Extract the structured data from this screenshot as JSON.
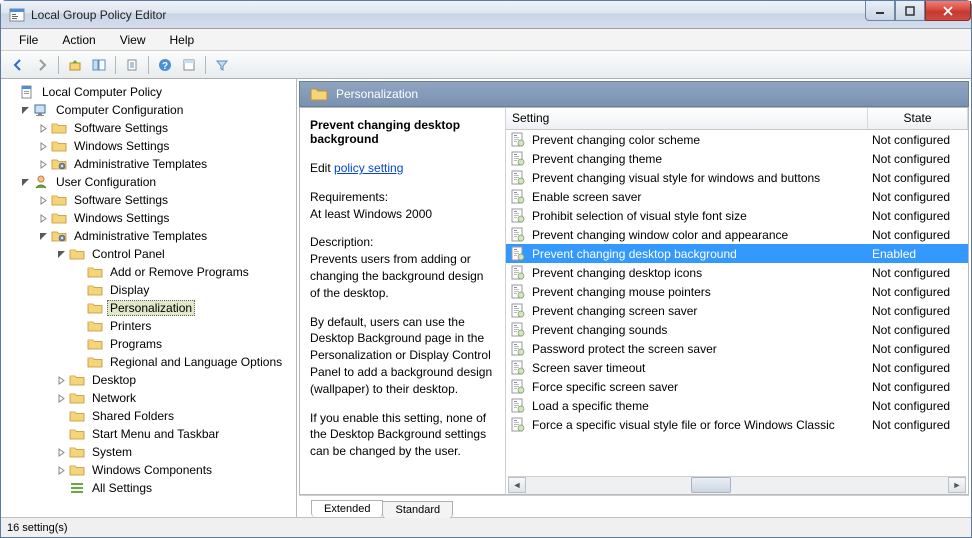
{
  "window": {
    "title": "Local Group Policy Editor"
  },
  "menu": {
    "file": "File",
    "action": "Action",
    "view": "View",
    "help": "Help"
  },
  "tree": {
    "root": "Local Computer Policy",
    "cc": "Computer Configuration",
    "cc_sw": "Software Settings",
    "cc_win": "Windows Settings",
    "cc_admin": "Administrative Templates",
    "uc": "User Configuration",
    "uc_sw": "Software Settings",
    "uc_win": "Windows Settings",
    "uc_admin": "Administrative Templates",
    "cp": "Control Panel",
    "cp_add": "Add or Remove Programs",
    "cp_disp": "Display",
    "cp_pers": "Personalization",
    "cp_print": "Printers",
    "cp_prog": "Programs",
    "cp_reg": "Regional and Language Options",
    "desktop": "Desktop",
    "network": "Network",
    "shared": "Shared Folders",
    "start": "Start Menu and Taskbar",
    "system": "System",
    "wincomp": "Windows Components",
    "allset": "All Settings"
  },
  "header": {
    "title": "Personalization"
  },
  "desc": {
    "title": "Prevent changing desktop background",
    "edit_prefix": "Edit ",
    "edit_link": "policy setting",
    "req_label": "Requirements:",
    "req_text": "At least Windows 2000",
    "desc_label": "Description:",
    "p1": "Prevents users from adding or changing the background design of the desktop.",
    "p2": "By default, users can use the Desktop Background page in the Personalization or Display Control Panel to add a background design (wallpaper) to their desktop.",
    "p3": "If you enable this setting, none of the Desktop Background settings can be changed by the user."
  },
  "cols": {
    "setting": "Setting",
    "state": "State"
  },
  "settings": [
    {
      "name": "Prevent changing color scheme",
      "state": "Not configured",
      "sel": false
    },
    {
      "name": "Prevent changing theme",
      "state": "Not configured",
      "sel": false
    },
    {
      "name": "Prevent changing visual style for windows and buttons",
      "state": "Not configured",
      "sel": false
    },
    {
      "name": "Enable screen saver",
      "state": "Not configured",
      "sel": false
    },
    {
      "name": "Prohibit selection of visual style font size",
      "state": "Not configured",
      "sel": false
    },
    {
      "name": "Prevent changing window color and appearance",
      "state": "Not configured",
      "sel": false
    },
    {
      "name": "Prevent changing desktop background",
      "state": "Enabled",
      "sel": true
    },
    {
      "name": "Prevent changing desktop icons",
      "state": "Not configured",
      "sel": false
    },
    {
      "name": "Prevent changing mouse pointers",
      "state": "Not configured",
      "sel": false
    },
    {
      "name": "Prevent changing screen saver",
      "state": "Not configured",
      "sel": false
    },
    {
      "name": "Prevent changing sounds",
      "state": "Not configured",
      "sel": false
    },
    {
      "name": "Password protect the screen saver",
      "state": "Not configured",
      "sel": false
    },
    {
      "name": "Screen saver timeout",
      "state": "Not configured",
      "sel": false
    },
    {
      "name": "Force specific screen saver",
      "state": "Not configured",
      "sel": false
    },
    {
      "name": "Load a specific theme",
      "state": "Not configured",
      "sel": false
    },
    {
      "name": "Force a specific visual style file or force Windows Classic",
      "state": "Not configured",
      "sel": false
    }
  ],
  "tabs": {
    "extended": "Extended",
    "standard": "Standard"
  },
  "status": "16 setting(s)"
}
